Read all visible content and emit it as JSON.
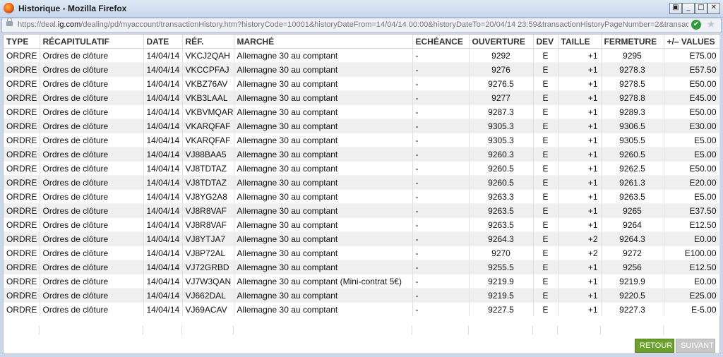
{
  "window": {
    "title": "Historique - Mozilla Firefox",
    "url_prefix": "https://deal.",
    "url_host": "ig.com",
    "url_rest": "/dealing/pd/myaccount/transactionHistory.htm?historyCode=10001&historyDateFrom=14/04/14 00:00&historyDateTo=20/04/14 23:59&transactionHistoryPageNumber=2&transactic",
    "buttons": {
      "minimize": "_",
      "maximize": "□",
      "close": "✕",
      "extra": "▣"
    },
    "check_glyph": "✔",
    "star_glyph": "★"
  },
  "table": {
    "headers": [
      "TYPE",
      "RÉCAPITULATIF",
      "DATE",
      "RÉF.",
      "MARCHÉ",
      "ECHÉANCE",
      "OUVERTURE",
      "DEV",
      "TAILLE",
      "FERMETURE",
      "+/– VALUES"
    ],
    "rows": [
      [
        "ORDRE",
        "Ordres de clôture",
        "14/04/14",
        "VKCJ2QAH",
        "Allemagne 30 au comptant",
        "-",
        "9292",
        "E",
        "+1",
        "9295",
        "E75.00"
      ],
      [
        "ORDRE",
        "Ordres de clôture",
        "14/04/14",
        "VKCCPFAJ",
        "Allemagne 30 au comptant",
        "-",
        "9276",
        "E",
        "+1",
        "9278.3",
        "E57.50"
      ],
      [
        "ORDRE",
        "Ordres de clôture",
        "14/04/14",
        "VKBZ76AV",
        "Allemagne 30 au comptant",
        "-",
        "9276.5",
        "E",
        "+1",
        "9278.5",
        "E50.00"
      ],
      [
        "ORDRE",
        "Ordres de clôture",
        "14/04/14",
        "VKB3LAAL",
        "Allemagne 30 au comptant",
        "-",
        "9277",
        "E",
        "+1",
        "9278.8",
        "E45.00"
      ],
      [
        "ORDRE",
        "Ordres de clôture",
        "14/04/14",
        "VKBVMQAR",
        "Allemagne 30 au comptant",
        "-",
        "9287.3",
        "E",
        "+1",
        "9289.3",
        "E50.00"
      ],
      [
        "ORDRE",
        "Ordres de clôture",
        "14/04/14",
        "VKARQFAF",
        "Allemagne 30 au comptant",
        "-",
        "9305.3",
        "E",
        "+1",
        "9306.5",
        "E30.00"
      ],
      [
        "ORDRE",
        "Ordres de clôture",
        "14/04/14",
        "VKARQFAF",
        "Allemagne 30 au comptant",
        "-",
        "9305.3",
        "E",
        "+1",
        "9305.5",
        "E5.00"
      ],
      [
        "ORDRE",
        "Ordres de clôture",
        "14/04/14",
        "VJ88BAA5",
        "Allemagne 30 au comptant",
        "-",
        "9260.3",
        "E",
        "+1",
        "9260.5",
        "E5.00"
      ],
      [
        "ORDRE",
        "Ordres de clôture",
        "14/04/14",
        "VJ8TDTAZ",
        "Allemagne 30 au comptant",
        "-",
        "9260.5",
        "E",
        "+1",
        "9262.5",
        "E50.00"
      ],
      [
        "ORDRE",
        "Ordres de clôture",
        "14/04/14",
        "VJ8TDTAZ",
        "Allemagne 30 au comptant",
        "-",
        "9260.5",
        "E",
        "+1",
        "9261.3",
        "E20.00"
      ],
      [
        "ORDRE",
        "Ordres de clôture",
        "14/04/14",
        "VJ8YG2A8",
        "Allemagne 30 au comptant",
        "-",
        "9263.3",
        "E",
        "+1",
        "9263.5",
        "E5.00"
      ],
      [
        "ORDRE",
        "Ordres de clôture",
        "14/04/14",
        "VJ8R8VAF",
        "Allemagne 30 au comptant",
        "-",
        "9263.5",
        "E",
        "+1",
        "9265",
        "E37.50"
      ],
      [
        "ORDRE",
        "Ordres de clôture",
        "14/04/14",
        "VJ8R8VAF",
        "Allemagne 30 au comptant",
        "-",
        "9263.5",
        "E",
        "+1",
        "9264",
        "E12.50"
      ],
      [
        "ORDRE",
        "Ordres de clôture",
        "14/04/14",
        "VJ8YTJA7",
        "Allemagne 30 au comptant",
        "-",
        "9264.3",
        "E",
        "+2",
        "9264.3",
        "E0.00"
      ],
      [
        "ORDRE",
        "Ordres de clôture",
        "14/04/14",
        "VJ8P72AL",
        "Allemagne 30 au comptant",
        "-",
        "9270",
        "E",
        "+2",
        "9272",
        "E100.00"
      ],
      [
        "ORDRE",
        "Ordres de clôture",
        "14/04/14",
        "VJ72GRBD",
        "Allemagne 30 au comptant",
        "-",
        "9255.5",
        "E",
        "+1",
        "9256",
        "E12.50"
      ],
      [
        "ORDRE",
        "Ordres de clôture",
        "14/04/14",
        "VJ7W3QAN",
        "Allemagne 30 au comptant (Mini-contrat 5€)",
        "-",
        "9219.9",
        "E",
        "+1",
        "9219.9",
        "E0.00"
      ],
      [
        "ORDRE",
        "Ordres de clôture",
        "14/04/14",
        "VJ662DAL",
        "Allemagne 30 au comptant",
        "-",
        "9219.5",
        "E",
        "+1",
        "9220.5",
        "E25.00"
      ],
      [
        "ORDRE",
        "Ordres de clôture",
        "14/04/14",
        "VJ69ACAV",
        "Allemagne 30 au comptant",
        "-",
        "9227.5",
        "E",
        "+1",
        "9227.3",
        "E-5.00"
      ]
    ]
  },
  "footer": {
    "retour_label": "RETOUR",
    "suivant_label": "SUIVANT"
  },
  "colors": {
    "retour_button": "#6aa12d",
    "suivant_button": "#c7c7c7",
    "row_stripe": "#efefef",
    "secure_check": "#2e9a3b"
  }
}
